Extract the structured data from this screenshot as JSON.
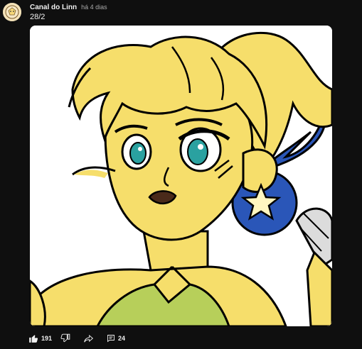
{
  "post": {
    "channel_name": "Canal do Linn",
    "time_ago": "há 4 dias",
    "text": "28/2"
  },
  "actions": {
    "like_count": "191",
    "comment_count": "24"
  },
  "icons": {
    "like": "thumbs-up-icon",
    "dislike": "thumbs-down-icon",
    "share": "share-icon",
    "comments": "comments-icon"
  },
  "colors": {
    "background": "#0f0f0f",
    "text": "#f1f1f1",
    "muted": "#aaaaaa"
  }
}
